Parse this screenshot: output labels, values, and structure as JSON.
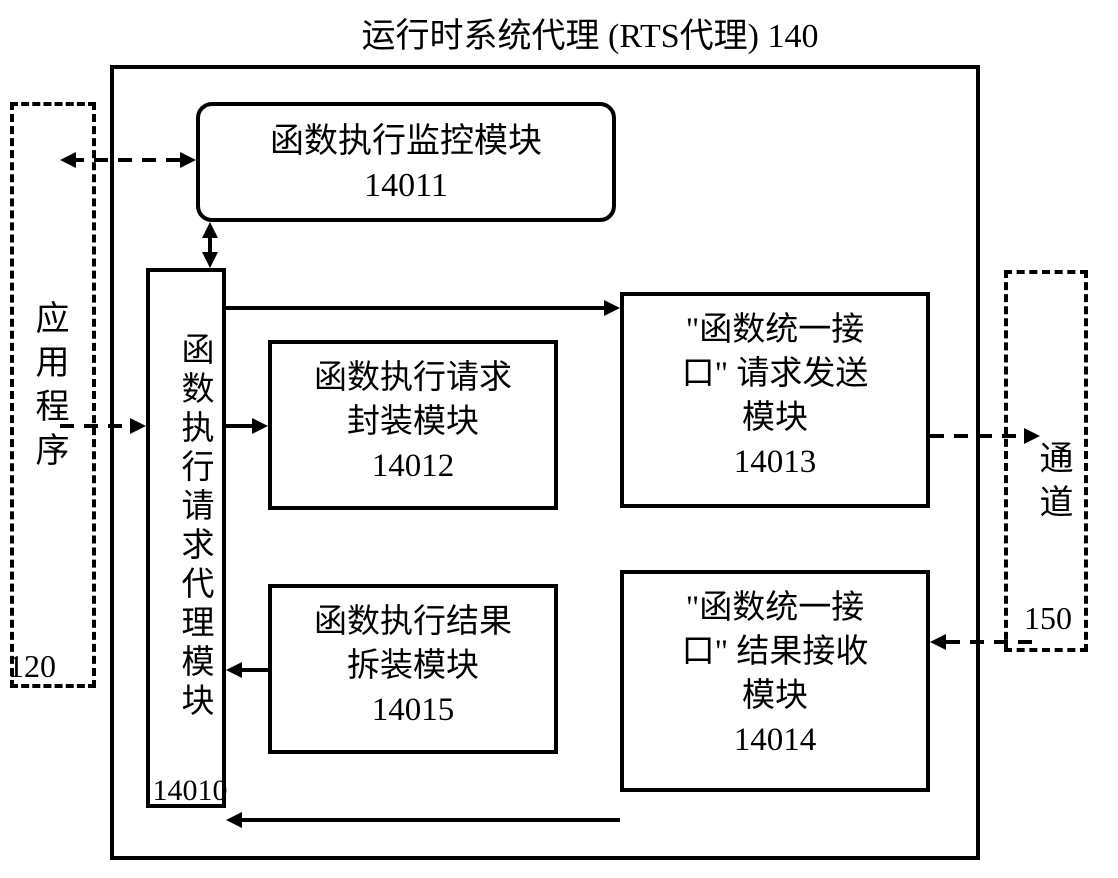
{
  "title": "运行时系统代理 (RTS代理)  140",
  "app": {
    "label": "应用程序",
    "ref": "120"
  },
  "channel": {
    "label": "通道",
    "ref": "150"
  },
  "boxes": {
    "monitor": {
      "line1": "函数执行监控模块",
      "ref": "14011"
    },
    "proxy": {
      "label": "函数执行请求代理模块",
      "ref": "14010"
    },
    "pack": {
      "line1": "函数执行请求",
      "line2": "封装模块",
      "ref": "14012"
    },
    "send": {
      "line1": "\"函数统一接",
      "line2": "口\" 请求发送",
      "line3": "模块",
      "ref": "14013"
    },
    "unpack": {
      "line1": "函数执行结果",
      "line2": "拆装模块",
      "ref": "14015"
    },
    "recv": {
      "line1": "\"函数统一接",
      "line2": "口\" 结果接收",
      "line3": "模块",
      "ref": "14014"
    }
  }
}
